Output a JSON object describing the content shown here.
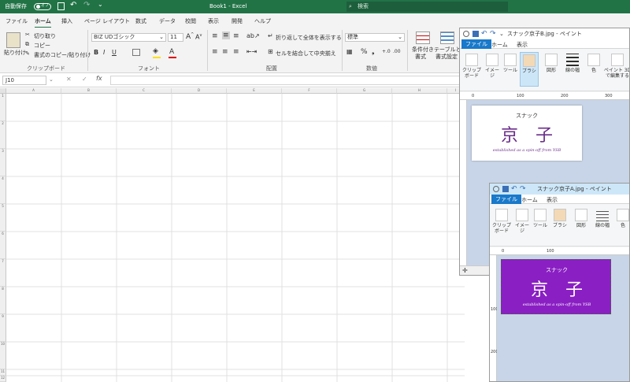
{
  "excel": {
    "autosave": "自動保存",
    "autosave_state": "オフ",
    "title": "Book1  -  Excel",
    "search_placeholder": "検索",
    "menu": [
      "ファイル",
      "ホーム",
      "挿入",
      "ページ レイアウト",
      "数式",
      "データ",
      "校閲",
      "表示",
      "開発",
      "ヘルプ"
    ],
    "ribbon": {
      "paste": "貼り付け",
      "cut": "切り取り",
      "copy": "コピー",
      "format_painter": "書式のコピー/貼り付け",
      "clipboard_label": "クリップボード",
      "font_name": "BIZ UDゴシック",
      "font_size": "11",
      "font_label": "フォント",
      "wrap_text": "折り返して全体を表示する",
      "merge_center": "セルを結合して中央揃え",
      "alignment_label": "配置",
      "number_format": "標準",
      "number_label": "数値",
      "cond_format_1": "条件付き",
      "cond_format_2": "書式",
      "table_1": "テーブルとし",
      "table_2": "書式設定"
    },
    "namebox": "J10",
    "columns": [
      "A",
      "B",
      "C",
      "D",
      "E",
      "F",
      "G",
      "H",
      "I"
    ],
    "rows": [
      "1",
      "2",
      "3",
      "4",
      "5",
      "6",
      "7",
      "8",
      "9",
      "10",
      "11",
      "12"
    ]
  },
  "paint_b": {
    "title": "スナック京子B.jpg - ペイント",
    "tabs": [
      "ファイル",
      "ホーム",
      "表示"
    ],
    "tools": [
      "クリップボード",
      "イメージ",
      "ツール",
      "ブラシ",
      "図形",
      "線の幅",
      "色",
      "ペイント 3D で編集する"
    ],
    "ruler": [
      "0",
      "100",
      "200",
      "300"
    ],
    "image": {
      "line1": "スナック",
      "line2": "京　子",
      "line3": "established as a spin-off from YSB"
    }
  },
  "paint_a": {
    "title": "スナック京子A.jpg - ペイント",
    "tabs": [
      "ファイル",
      "ホーム",
      "表示"
    ],
    "tools": [
      "クリップボード",
      "イメージ",
      "ツール",
      "ブラシ",
      "図形",
      "線の幅",
      "色"
    ],
    "ruler_h": [
      "0",
      "100"
    ],
    "ruler_v": [
      "100",
      "200"
    ],
    "image": {
      "line1": "スナック",
      "line2": "京　子",
      "line3": "established as a spin-off from YSB"
    }
  },
  "colors": {
    "excel_green": "#217346",
    "paint_blue": "#1979ca",
    "sign_purple": "#8a1fc3",
    "text_purple": "#6a2d8a"
  }
}
